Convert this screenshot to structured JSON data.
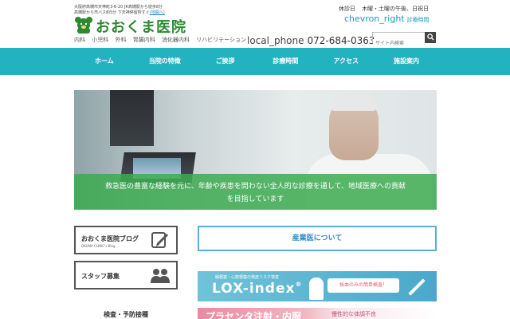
{
  "header": {
    "address_line1": "大阪府高槻市天神町3-6-20 JR高槻駅から徒歩8分",
    "address_line2": "高槻駅から市バス約5分 下天神停留所すぐ",
    "map_link": "(地図へ)",
    "clinic_name": "おおくま医院",
    "departments": [
      "内科",
      "小児科",
      "外科",
      "胃腸内科",
      "消化器内科",
      "リハビリテーション"
    ],
    "phone_icon_text": "local_phone",
    "phone_number": "072-684-0363",
    "closed_label": "休診日",
    "closed_days": "木曜・土曜の午後、日祝日",
    "hours_icon_text": "chevron_right",
    "hours_link": "診療時間",
    "search_placeholder": "サイト内検索",
    "search_icon": "search-icon"
  },
  "nav": {
    "items": [
      "ホーム",
      "当院の特徴",
      "ご挨拶",
      "診療時間",
      "アクセス",
      "施設案内"
    ]
  },
  "hero": {
    "caption_line1": "救急医の豊富な経験を元に、年齢や疾患を問わない全人的な診療を通して、地域医療への貢献",
    "caption_line2": "を目指しています"
  },
  "sidebar": {
    "blog_title": "おおくま医院ブログ",
    "blog_subtitle": "OKUMA CLINIC's Blog",
    "staff_title": "スタッフ募集",
    "exam_heading": "検査・予防接種"
  },
  "main": {
    "sangyo_button": "産業医について",
    "lox_small": "脳梗塞・心筋梗塞の発症リスク検査",
    "lox_big": "LOX-index",
    "lox_reg": "®",
    "lox_pill": "採血のみの簡単検査！",
    "placenta_title": "プラセンタ注射・内服",
    "placenta_right": "慢性的な体調不良"
  },
  "colors": {
    "nav_bg": "#22b2c0",
    "brand_green": "#2a8a2e",
    "caption_green": "#3caa50",
    "accent_blue": "#2a8fc6"
  }
}
